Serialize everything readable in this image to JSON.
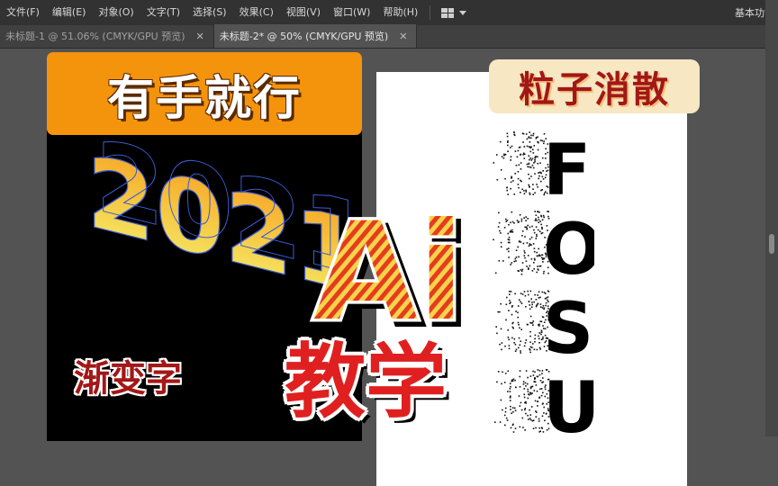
{
  "menubar": {
    "items": [
      "文件(F)",
      "编辑(E)",
      "对象(O)",
      "文字(T)",
      "选择(S)",
      "效果(C)",
      "视图(V)",
      "窗口(W)",
      "帮助(H)"
    ],
    "workspace_label": "基本功能"
  },
  "tabs": [
    {
      "label": "未标题-1 @ 51.06% (CMYK/GPU 预览)",
      "active": false
    },
    {
      "label": "未标题-2* @ 50% (CMYK/GPU 预览)",
      "active": true
    }
  ],
  "overlay": {
    "title": "有手就行",
    "particle_label": "粒子消散",
    "gradient_label": "渐变字",
    "ai_logo": "Ai",
    "teach_label": "教学"
  },
  "artwork": {
    "gradient_digits": "2021",
    "fosu_letters": [
      "F",
      "O",
      "S",
      "U"
    ]
  },
  "colors": {
    "orange_badge": "#f4940c",
    "red_text": "#e02020",
    "dark_red": "#a21717",
    "cream_badge": "#f7e7c3",
    "gradient_top": "#f7b227",
    "gradient_bottom": "#f4ee6a"
  }
}
